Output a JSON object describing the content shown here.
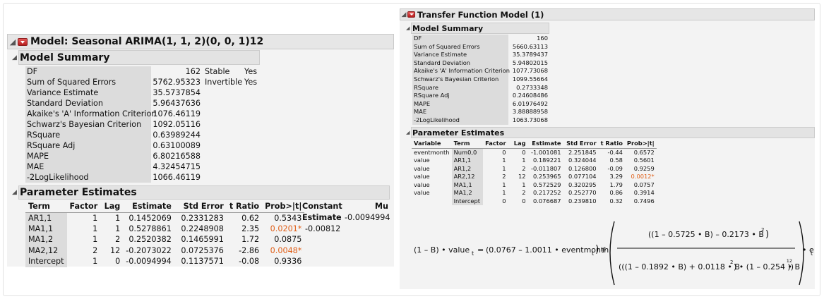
{
  "left": {
    "title": "Model: Seasonal ARIMA(1, 1, 2)(0, 0, 1)12",
    "model_summary": {
      "header": "Model Summary",
      "rows": [
        {
          "label": "DF",
          "value": "162"
        },
        {
          "label": "Sum of Squared Errors",
          "value": "5762.95323"
        },
        {
          "label": "Variance Estimate",
          "value": "35.5737854"
        },
        {
          "label": "Standard Deviation",
          "value": "5.96437636"
        },
        {
          "label": "Akaike's 'A' Information Criterion",
          "value": "1076.46119"
        },
        {
          "label": "Schwarz's Bayesian Criterion",
          "value": "1092.05116"
        },
        {
          "label": "RSquare",
          "value": "0.63989244"
        },
        {
          "label": "RSquare Adj",
          "value": "0.63100089"
        },
        {
          "label": "MAPE",
          "value": "6.80216588"
        },
        {
          "label": "MAE",
          "value": "4.32454715"
        },
        {
          "label": "-2LogLikelihood",
          "value": "1066.46119"
        }
      ],
      "stable_label": "Stable",
      "stable_value": "Yes",
      "invertible_label": "Invertible",
      "invertible_value": "Yes"
    },
    "parameter_estimates": {
      "header": "Parameter Estimates",
      "columns": [
        "Term",
        "Factor",
        "Lag",
        "Estimate",
        "Std Error",
        "t Ratio",
        "Prob>|t|"
      ],
      "rows": [
        {
          "term": "AR1,1",
          "factor": "1",
          "lag": "1",
          "estimate": "0.1452069",
          "std_error": "0.2331283",
          "t_ratio": "0.62",
          "prob": "0.5343"
        },
        {
          "term": "MA1,1",
          "factor": "1",
          "lag": "1",
          "estimate": "0.5278861",
          "std_error": "0.2248908",
          "t_ratio": "2.35",
          "prob": "0.0201*"
        },
        {
          "term": "MA1,2",
          "factor": "1",
          "lag": "2",
          "estimate": "0.2520382",
          "std_error": "0.1465991",
          "t_ratio": "1.72",
          "prob": "0.0875"
        },
        {
          "term": "MA2,12",
          "factor": "2",
          "lag": "12",
          "estimate": "-0.2073022",
          "std_error": "0.0725376",
          "t_ratio": "-2.86",
          "prob": "0.0048*"
        },
        {
          "term": "Intercept",
          "factor": "1",
          "lag": "0",
          "estimate": "-0.0094994",
          "std_error": "0.1137571",
          "t_ratio": "-0.08",
          "prob": "0.9336"
        }
      ],
      "constant_label": "Constant",
      "constant_estimate_label": "Estimate",
      "constant_value": "-0.00812",
      "mu_label": "Mu",
      "mu_value": "-0.0094994"
    }
  },
  "right": {
    "title": "Transfer Function Model (1)",
    "model_summary": {
      "header": "Model Summary",
      "rows": [
        {
          "label": "DF",
          "value": "160"
        },
        {
          "label": "Sum of Squared Errors",
          "value": "5660.63113"
        },
        {
          "label": "Variance Estimate",
          "value": "35.3789437"
        },
        {
          "label": "Standard Deviation",
          "value": "5.94802015"
        },
        {
          "label": "Akaike's 'A' Information Criterion",
          "value": "1077.73068"
        },
        {
          "label": "Schwarz's Bayesian Criterion",
          "value": "1099.55664"
        },
        {
          "label": "RSquare",
          "value": "0.2733348"
        },
        {
          "label": "RSquare Adj",
          "value": "0.24608486"
        },
        {
          "label": "MAPE",
          "value": "6.01976492"
        },
        {
          "label": "MAE",
          "value": "3.88888958"
        },
        {
          "label": "-2LogLikelihood",
          "value": "1063.73068"
        }
      ]
    },
    "parameter_estimates": {
      "header": "Parameter Estimates",
      "columns": [
        "Variable",
        "Term",
        "Factor",
        "Lag",
        "Estimate",
        "Std Error",
        "t Ratio",
        "Prob>|t|"
      ],
      "rows": [
        {
          "variable": "eventmonth",
          "term": "Num0,0",
          "factor": "0",
          "lag": "0",
          "estimate": "-1.001081",
          "std_error": "2.251845",
          "t_ratio": "-0.44",
          "prob": "0.6572"
        },
        {
          "variable": "value",
          "term": "AR1,1",
          "factor": "1",
          "lag": "1",
          "estimate": "0.189221",
          "std_error": "0.324044",
          "t_ratio": "0.58",
          "prob": "0.5601"
        },
        {
          "variable": "value",
          "term": "AR1,2",
          "factor": "1",
          "lag": "2",
          "estimate": "-0.011807",
          "std_error": "0.126800",
          "t_ratio": "-0.09",
          "prob": "0.9259"
        },
        {
          "variable": "value",
          "term": "AR2,12",
          "factor": "2",
          "lag": "12",
          "estimate": "0.253965",
          "std_error": "0.077104",
          "t_ratio": "3.29",
          "prob": "0.0012*"
        },
        {
          "variable": "value",
          "term": "MA1,1",
          "factor": "1",
          "lag": "1",
          "estimate": "0.572529",
          "std_error": "0.320295",
          "t_ratio": "1.79",
          "prob": "0.0757"
        },
        {
          "variable": "value",
          "term": "MA1,2",
          "factor": "1",
          "lag": "2",
          "estimate": "0.217252",
          "std_error": "0.252770",
          "t_ratio": "0.86",
          "prob": "0.3914"
        },
        {
          "variable": "",
          "term": "Intercept",
          "factor": "0",
          "lag": "0",
          "estimate": "0.076687",
          "std_error": "0.239810",
          "t_ratio": "0.32",
          "prob": "0.7496"
        }
      ]
    },
    "formula": {
      "lhs_diff": "(1 – B) • value",
      "lhs_sub": "t",
      "eq": "=",
      "input_term": "(0.0767 – 1.0011 • eventmonth",
      "input_sub": "t",
      "input_close": ")",
      "plus": "+",
      "numerator": "((1 – 0.5725 • B) – 0.2173 • B",
      "numerator_exp": "2",
      "numerator_close": ")",
      "den_part1": "(((1 – 0.1892 • B) + 0.0118 • B",
      "den_part1_exp": "2",
      "den_part1_close": ") • (1 – 0.254 • B",
      "den_part2_exp": "12",
      "den_part2_close": "))",
      "error_term": "• e",
      "error_sub": "t"
    }
  },
  "colors": {
    "significant": "#e0601a",
    "red_button": "#c8282a",
    "header_bg": "#e6e6e6",
    "label_bg": "#dcdcdc"
  }
}
